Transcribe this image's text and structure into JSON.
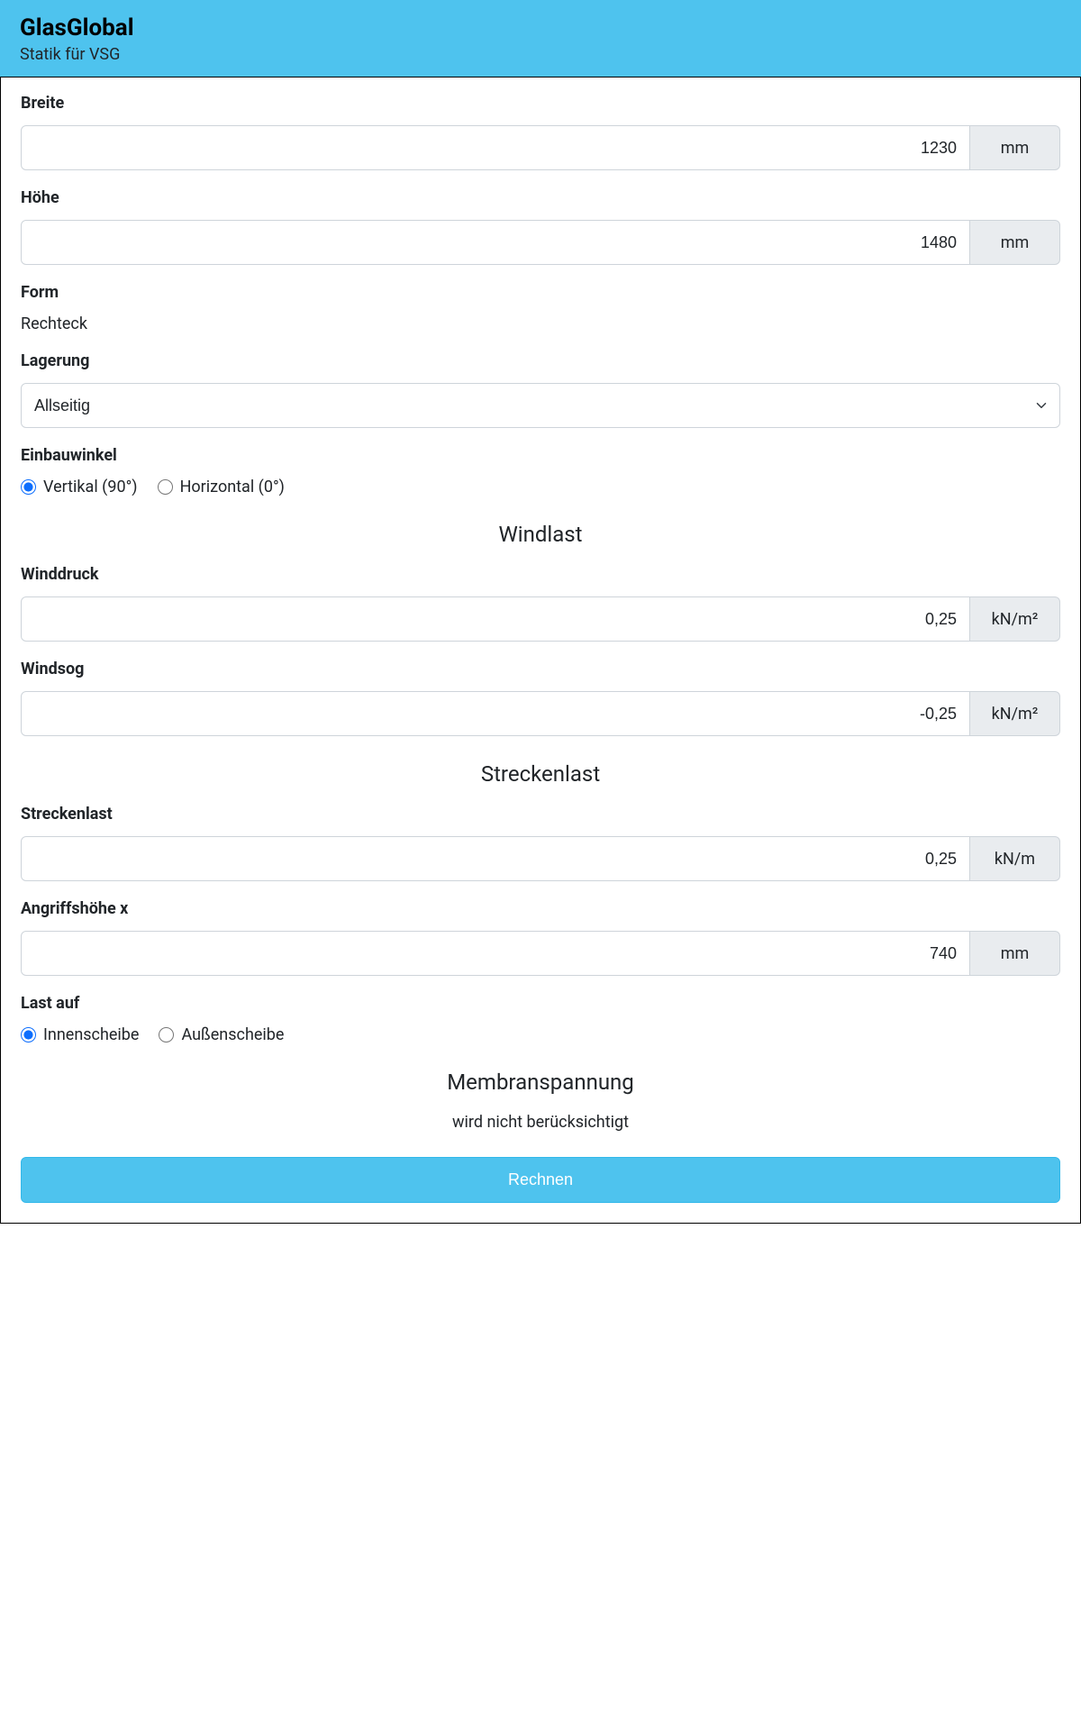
{
  "header": {
    "title": "GlasGlobal",
    "subtitle": "Statik für VSG"
  },
  "form": {
    "breite": {
      "label": "Breite",
      "value": "1230",
      "unit": "mm"
    },
    "hoehe": {
      "label": "Höhe",
      "value": "1480",
      "unit": "mm"
    },
    "form": {
      "label": "Form",
      "value": "Rechteck"
    },
    "lagerung": {
      "label": "Lagerung",
      "selected": "Allseitig"
    },
    "einbauwinkel": {
      "label": "Einbauwinkel",
      "options": {
        "vertikal": "Vertikal (90°)",
        "horizontal": "Horizontal (0°)"
      }
    },
    "windlast_heading": "Windlast",
    "winddruck": {
      "label": "Winddruck",
      "value": "0,25",
      "unit": "kN/m²"
    },
    "windsog": {
      "label": "Windsog",
      "value": "-0,25",
      "unit": "kN/m²"
    },
    "streckenlast_heading": "Streckenlast",
    "streckenlast": {
      "label": "Streckenlast",
      "value": "0,25",
      "unit": "kN/m"
    },
    "angriffshoehe": {
      "label": "Angriffshöhe x",
      "value": "740",
      "unit": "mm"
    },
    "last_auf": {
      "label": "Last auf",
      "options": {
        "innen": "Innenscheibe",
        "aussen": "Außenscheibe"
      }
    },
    "membranspannung_heading": "Membranspannung",
    "membranspannung_info": "wird nicht berücksichtigt",
    "submit_label": "Rechnen"
  }
}
